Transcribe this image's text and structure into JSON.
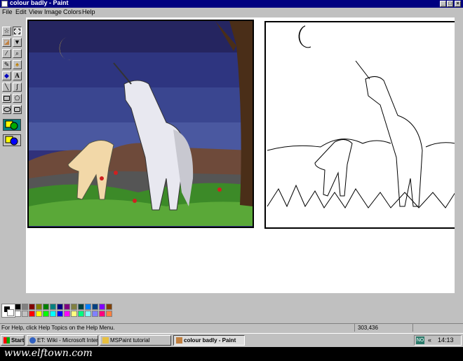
{
  "window": {
    "title": "colour badly - Paint",
    "controls": [
      "_",
      "□",
      "×"
    ]
  },
  "menu": [
    "File",
    "Edit",
    "View",
    "Image",
    "Colors",
    "Help"
  ],
  "toolbox": [
    "free-select",
    "rect-select",
    "eraser",
    "fill-bucket",
    "color-picker",
    "magnifier",
    "pencil",
    "brush",
    "airbrush",
    "text",
    "line",
    "curve",
    "rectangle",
    "polygon",
    "ellipse",
    "rounded-rectangle"
  ],
  "palette": {
    "row1": [
      "#000000",
      "#808080",
      "#800000",
      "#808000",
      "#008000",
      "#008080",
      "#000080",
      "#800080",
      "#808040",
      "#004040",
      "#0080ff",
      "#004080",
      "#8000ff",
      "#804000"
    ],
    "row2": [
      "#ffffff",
      "#c0c0c0",
      "#ff0000",
      "#ffff00",
      "#00ff00",
      "#00ffff",
      "#0000ff",
      "#ff00ff",
      "#ffff80",
      "#00ff80",
      "#80ffff",
      "#8080ff",
      "#ff0080",
      "#ff8040"
    ]
  },
  "status": {
    "help": "For Help, click Help Topics on the Help Menu.",
    "coords": "303,436"
  },
  "taskbar": {
    "start": "Start",
    "buttons": [
      "ET: Wiki - Microsoft Intern...",
      "MSPaint tutorial",
      "colour badly - Paint"
    ],
    "tray_icon": "NO",
    "clock": "14:13"
  },
  "footer": {
    "watermark": "www.elftown.com"
  }
}
